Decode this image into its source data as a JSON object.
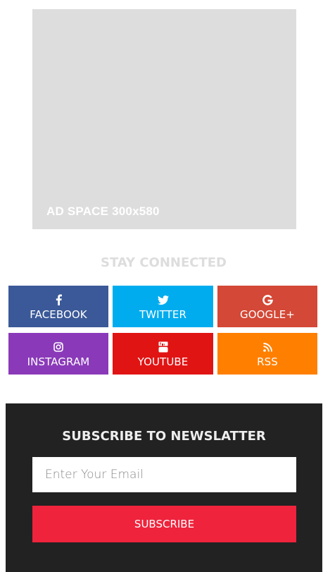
{
  "ad": {
    "label": "AD SPACE 300x580"
  },
  "stay_connected": {
    "title": "STAY CONNECTED",
    "buttons": [
      {
        "label": "FACEBOOK",
        "icon": "facebook-icon",
        "color": "#3b5998"
      },
      {
        "label": "TWITTER",
        "icon": "twitter-icon",
        "color": "#00acee"
      },
      {
        "label": "GOOGLE+",
        "icon": "google-icon",
        "color": "#d34836"
      },
      {
        "label": "INSTAGRAM",
        "icon": "instagram-icon",
        "color": "#8a3ab9"
      },
      {
        "label": "YOUTUBE",
        "icon": "youtube-icon",
        "color": "#e11414"
      },
      {
        "label": "RSS",
        "icon": "rss-icon",
        "color": "#ff7f00"
      }
    ]
  },
  "newsletter": {
    "title": "SUBSCRIBE TO NEWSLATTER",
    "email_placeholder": "Enter Your Email",
    "subscribe_label": "SUBSCRIBE",
    "background": "#222222",
    "button_color": "#ef233c"
  }
}
